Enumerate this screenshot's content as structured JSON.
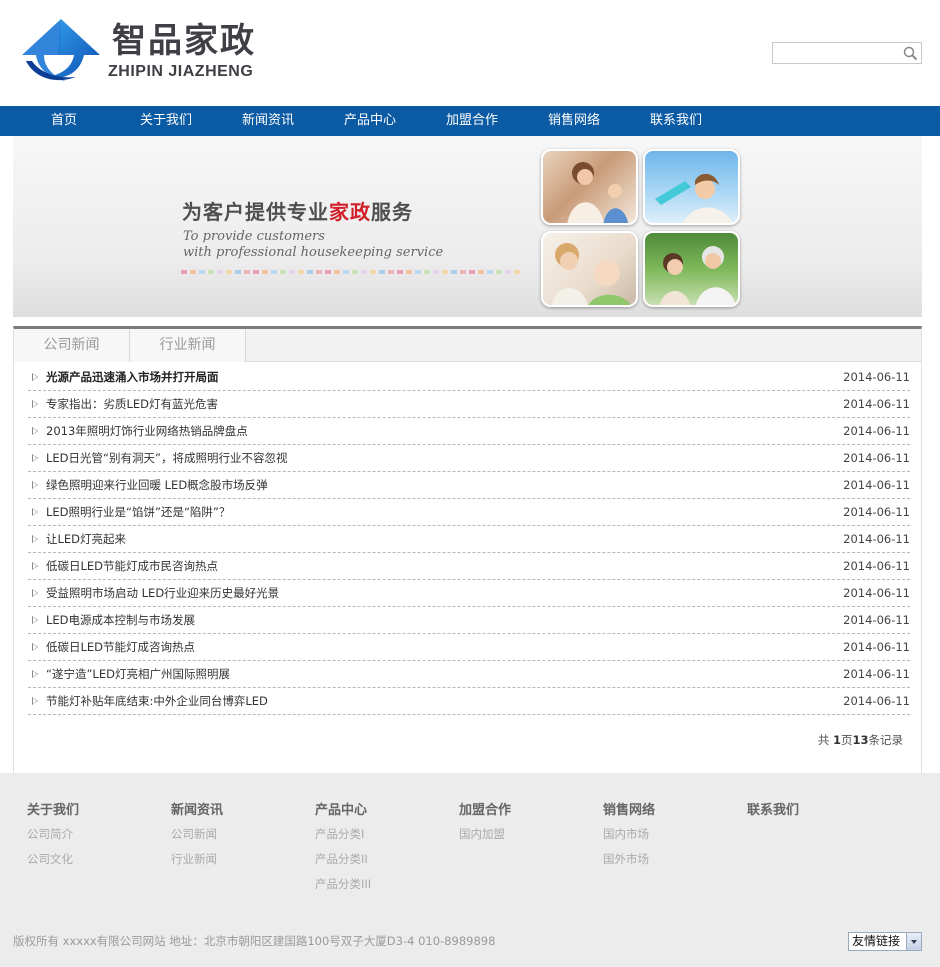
{
  "header": {
    "logo_cn": "智品家政",
    "logo_en": "ZHIPIN JIAZHENG",
    "search_value": "",
    "search_icon": "search-icon"
  },
  "nav": {
    "items": [
      "首页",
      "关于我们",
      "新闻资讯",
      "产品中心",
      "加盟合作",
      "销售网络",
      "联系我们"
    ]
  },
  "banner": {
    "title_pre": "为客户提供专业",
    "title_highlight": "家政",
    "title_post": "服务",
    "subtitle_line1": "To provide customers",
    "subtitle_line2": "with professional housekeeping service",
    "accent_color": "#d1202a"
  },
  "news": {
    "tabs": [
      "公司新闻",
      "行业新闻"
    ],
    "items": [
      {
        "title": "光源产品迅速涌入市场并打开局面",
        "date": "2014-06-11"
      },
      {
        "title": "专家指出：劣质LED灯有蓝光危害",
        "date": "2014-06-11"
      },
      {
        "title": "2013年照明灯饰行业网络热销品牌盘点",
        "date": "2014-06-11"
      },
      {
        "title": "LED日光管“别有洞天”，将成照明行业不容忽视",
        "date": "2014-06-11"
      },
      {
        "title": "绿色照明迎来行业回暖 LED概念股市场反弹",
        "date": "2014-06-11"
      },
      {
        "title": "LED照明行业是“馅饼”还是“陷阱”？",
        "date": "2014-06-11"
      },
      {
        "title": "让LED灯亮起来",
        "date": "2014-06-11"
      },
      {
        "title": "低碳日LED节能灯成市民咨询热点",
        "date": "2014-06-11"
      },
      {
        "title": "受益照明市场启动 LED行业迎来历史最好光景",
        "date": "2014-06-11"
      },
      {
        "title": "LED电源成本控制与市场发展",
        "date": "2014-06-11"
      },
      {
        "title": "低碳日LED节能灯成咨询热点",
        "date": "2014-06-11"
      },
      {
        "title": "“遂宁造”LED灯亮相广州国际照明展",
        "date": "2014-06-11"
      },
      {
        "title": "节能灯补贴年底结束:中外企业同台博弈LED",
        "date": "2014-06-11"
      }
    ],
    "pager": {
      "pre": "共 ",
      "page": "1",
      "mid": "页",
      "count": "13",
      "post": "条记录"
    }
  },
  "footer": {
    "columns": [
      {
        "head": "关于我们",
        "links": [
          "公司简介",
          "公司文化"
        ]
      },
      {
        "head": "新闻资讯",
        "links": [
          "公司新闻",
          "行业新闻"
        ]
      },
      {
        "head": "产品中心",
        "links": [
          "产品分类I",
          "产品分类II",
          "产品分类III"
        ]
      },
      {
        "head": "加盟合作",
        "links": [
          "国内加盟"
        ]
      },
      {
        "head": "销售网络",
        "links": [
          "国内市场",
          "国外市场"
        ]
      },
      {
        "head": "联系我们",
        "links": []
      }
    ],
    "copyright": "版权所有 xxxxx有限公司网站 地址：北京市朝阳区建国路100号双子大厦D3-4 010-8989898",
    "friend_links": "友情链接"
  }
}
